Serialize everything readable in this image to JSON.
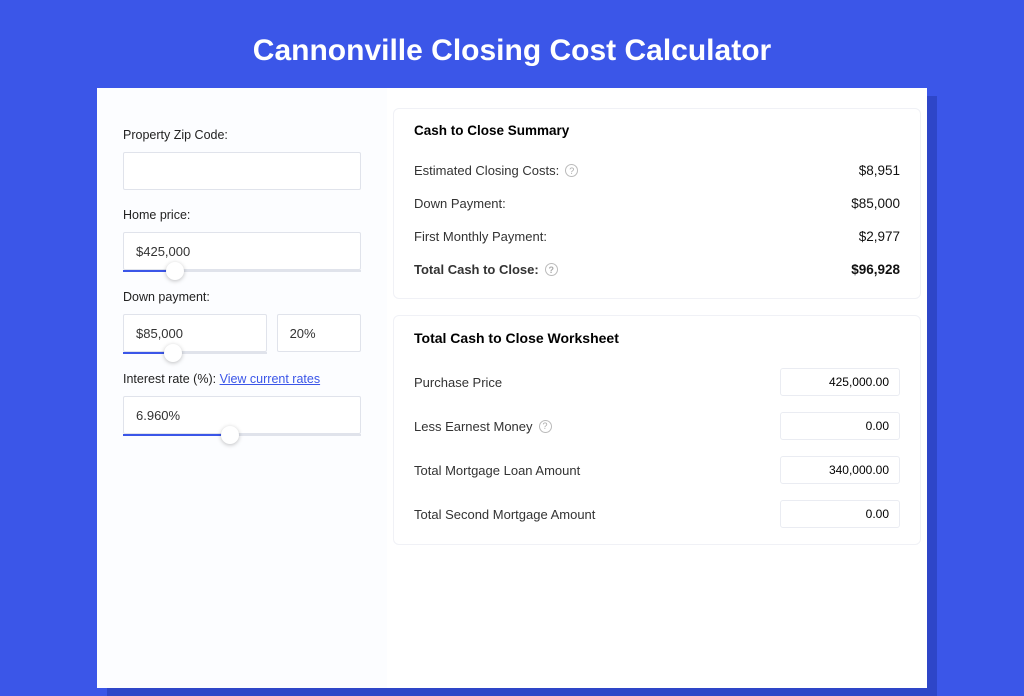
{
  "page": {
    "title": "Cannonville Closing Cost Calculator"
  },
  "inputs": {
    "zip_label": "Property Zip Code:",
    "zip_value": "",
    "home_price_label": "Home price:",
    "home_price_value": "$425,000",
    "down_payment_label": "Down payment:",
    "down_payment_value": "$85,000",
    "down_payment_pct": "20%",
    "interest_label": "Interest rate (%):",
    "interest_link": "View current rates",
    "interest_value": "6.960%"
  },
  "summary": {
    "title": "Cash to Close Summary",
    "estimated_label": "Estimated Closing Costs:",
    "estimated_value": "$8,951",
    "down_label": "Down Payment:",
    "down_value": "$85,000",
    "first_monthly_label": "First Monthly Payment:",
    "first_monthly_value": "$2,977",
    "total_label": "Total Cash to Close:",
    "total_value": "$96,928"
  },
  "worksheet": {
    "title": "Total Cash to Close Worksheet",
    "rows": [
      {
        "label": "Purchase Price",
        "value": "425,000.00",
        "help": false
      },
      {
        "label": "Less Earnest Money",
        "value": "0.00",
        "help": true
      },
      {
        "label": "Total Mortgage Loan Amount",
        "value": "340,000.00",
        "help": false
      },
      {
        "label": "Total Second Mortgage Amount",
        "value": "0.00",
        "help": false
      }
    ]
  }
}
